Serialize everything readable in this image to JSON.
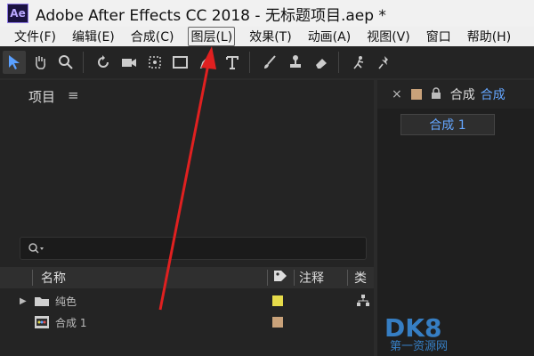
{
  "titlebar": {
    "logo": "Ae",
    "title": "Adobe After Effects CC 2018 - 无标题项目.aep *"
  },
  "menu": {
    "items": [
      "文件(F)",
      "编辑(E)",
      "合成(C)",
      "图层(L)",
      "效果(T)",
      "动画(A)",
      "视图(V)",
      "窗口",
      "帮助(H)"
    ],
    "highlighted_index": 3
  },
  "toolbar": {
    "icons": [
      "selection-tool-icon",
      "hand-tool-icon",
      "zoom-tool-icon",
      "rotate-tool-icon",
      "camera-tool-icon",
      "pan-behind-tool-icon",
      "rectangle-tool-icon",
      "pen-tool-icon",
      "type-tool-icon",
      "brush-tool-icon",
      "clone-stamp-tool-icon",
      "eraser-tool-icon",
      "roto-brush-tool-icon",
      "puppet-pin-tool-icon"
    ]
  },
  "project": {
    "title": "项目",
    "menu_icon": "≡",
    "search_icon": "search-icon",
    "columns": {
      "name": "名称",
      "note": "注释",
      "type": "类"
    },
    "rows": [
      {
        "expander": "▶",
        "folder_icon": "folder-icon",
        "name": "纯色",
        "label_color": "#e6db4a"
      },
      {
        "expander": "",
        "folder_icon": "composition-icon",
        "name": "合成 1",
        "label_color": "#c9a27a"
      }
    ]
  },
  "composition": {
    "tab_close": "×",
    "lock": "🔒",
    "label1": "合成",
    "label2": "合成",
    "subtab": "合成 1",
    "swatch": "#c9a27a"
  },
  "watermark": {
    "text": "DK8",
    "sub": "第一资源网"
  },
  "colors": {
    "accent_blue": "#64a6ff",
    "arrow_red": "#e02020"
  }
}
